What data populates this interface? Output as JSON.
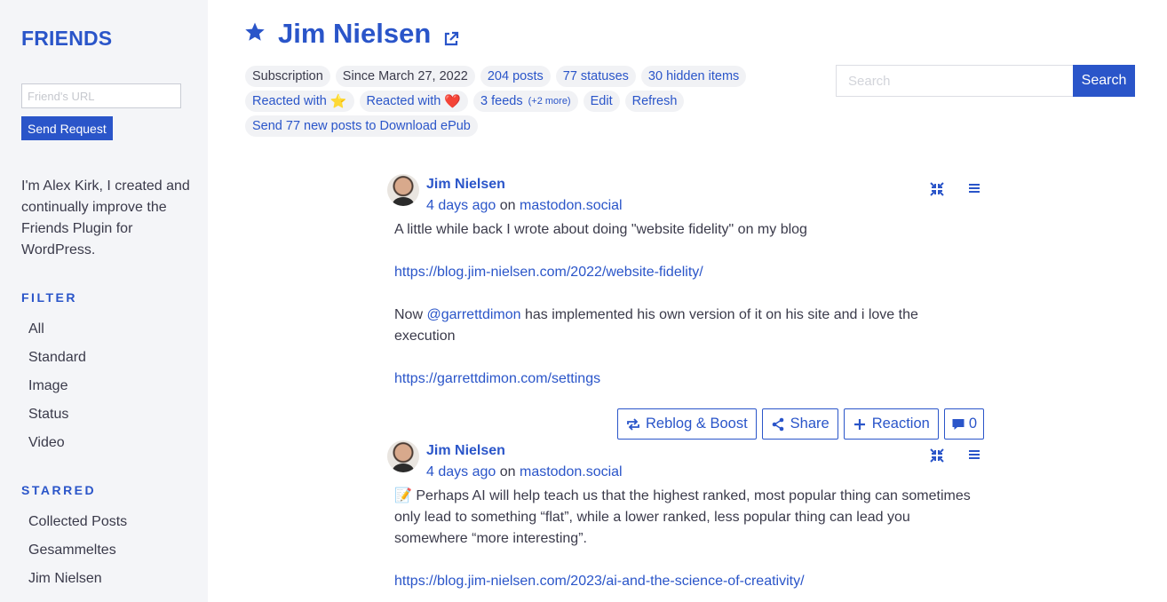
{
  "sidebar": {
    "site_title": "FRIENDS",
    "url_placeholder": "Friend's URL",
    "send_button": "Send Request",
    "about": "I'm Alex Kirk, I created and continually improve the Friends Plugin for WordPress.",
    "filter_heading": "FILTER",
    "filters": [
      "All",
      "Standard",
      "Image",
      "Status",
      "Video"
    ],
    "starred_heading": "STARRED",
    "starred": [
      "Collected Posts",
      "Gesammeltes",
      "Jim Nielsen"
    ]
  },
  "header": {
    "title": "Jim Nielsen",
    "chips": {
      "subscription": "Subscription",
      "since": "Since March 27, 2022",
      "posts": "204 posts",
      "statuses": "77 statuses",
      "hidden": "30 hidden items",
      "reacted_star": "Reacted with",
      "reacted_star_emoji": "⭐",
      "reacted_heart": "Reacted with",
      "reacted_heart_emoji": "❤️",
      "feeds": "3 feeds",
      "feeds_more": "(+2 more)",
      "edit": "Edit",
      "refresh": "Refresh",
      "epub": "Send 77 new posts to Download ePub"
    }
  },
  "search": {
    "placeholder": "Search",
    "button": "Search"
  },
  "posts": [
    {
      "author": "Jim Nielsen",
      "time": "4 days ago",
      "on": "on",
      "site": "mastodon.social",
      "p1": "A little while back I wrote about doing \"website fidelity\" on my blog",
      "link1": "https://blog.jim-nielsen.com/2022/website-fidelity/",
      "p2_before": "Now",
      "mention": "@garrettdimon",
      "p2_after": "has implemented his own version of it on his site and i love the execution",
      "link2": "https://garrettdimon.com/settings"
    },
    {
      "author": "Jim Nielsen",
      "time": "4 days ago",
      "on": "on",
      "site": "mastodon.social",
      "p1_emoji": "📝",
      "p1": "Perhaps AI will help teach us that the highest ranked, most popular thing can sometimes only lead to something “flat”, while a lower ranked, less popular thing can lead you somewhere “more interesting”.",
      "link1": "https://blog.jim-nielsen.com/2023/ai-and-the-science-of-creativity/"
    }
  ],
  "actions": {
    "reblog": "Reblog & Boost",
    "share": "Share",
    "reaction": "Reaction",
    "comments": "0"
  },
  "colors": {
    "accent": "#2a55c9",
    "sidebar_bg": "#f4f5f8",
    "chip_bg": "#f1f2f5",
    "text": "#3a3a4a"
  }
}
